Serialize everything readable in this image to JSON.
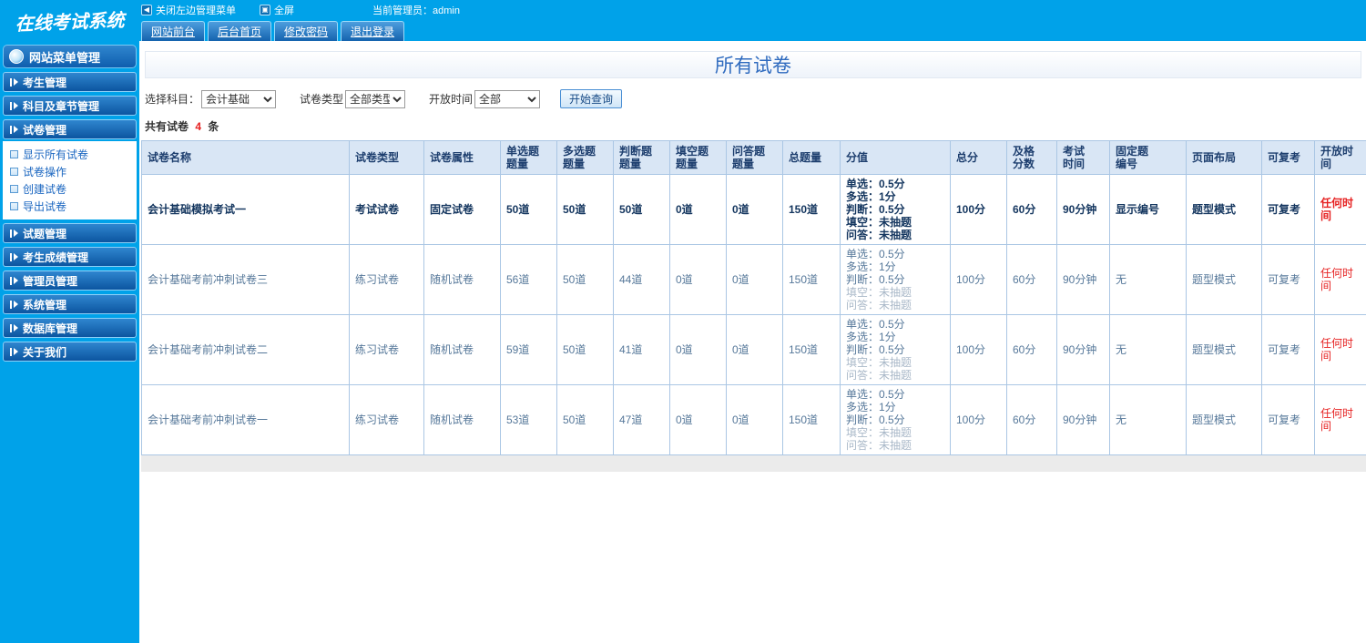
{
  "topbar": {
    "logo": "在线考试系统",
    "close_menu_label": "关闭左边管理菜单",
    "fullscreen_label": "全屏",
    "admin_text": "当前管理员：admin",
    "tabs": [
      "网站前台",
      "后台首页",
      "修改密码",
      "退出登录"
    ]
  },
  "sidebar": {
    "title": "网站菜单管理",
    "items": [
      "考生管理",
      "科目及章节管理",
      "试卷管理",
      "试题管理",
      "考生成绩管理",
      "管理员管理",
      "系统管理",
      "数据库管理",
      "关于我们"
    ],
    "paper_submenu": [
      "显示所有试卷",
      "试卷操作",
      "创建试卷",
      "导出试卷"
    ]
  },
  "main": {
    "title": "所有试卷",
    "filters": {
      "subject_label": "选择科目：",
      "subject_value": "会计基础",
      "type_label": "试卷类型",
      "type_value": "全部类型",
      "time_label": "开放时间",
      "time_value": "全部",
      "search_button": "开始查询"
    },
    "summary": {
      "prefix": "共有试卷",
      "count": "4",
      "suffix": "条"
    },
    "table": {
      "headers": [
        [
          "试卷名称"
        ],
        [
          "试卷类型"
        ],
        [
          "试卷属性"
        ],
        [
          "单选题",
          "题量"
        ],
        [
          "多选题",
          "题量"
        ],
        [
          "判断题",
          "题量"
        ],
        [
          "填空题",
          "题量"
        ],
        [
          "问答题",
          "题量"
        ],
        [
          "总题量"
        ],
        [
          "分值"
        ],
        [
          "总分"
        ],
        [
          "及格",
          "分数"
        ],
        [
          "考试",
          "时间"
        ],
        [
          "固定题",
          "编号"
        ],
        [
          "页面布局"
        ],
        [
          "可复考"
        ],
        [
          "开放时间"
        ]
      ],
      "rows": [
        {
          "name": "会计基础模拟考试一",
          "type": "考试试卷",
          "attr": "固定试卷",
          "single": "50道",
          "multi": "50道",
          "judge": "50道",
          "blank": "0道",
          "qa": "0道",
          "total": "150道",
          "score_lines": [
            "单选：0.5分",
            "多选：1分",
            "判断：0.5分",
            "填空：未抽题",
            "问答：未抽题"
          ],
          "total_score": "100分",
          "pass_score": "60分",
          "duration": "90分钟",
          "fixed_no": "显示编号",
          "layout": "题型模式",
          "retake": "可复考",
          "open_time": "任何时间",
          "emphasis": true
        },
        {
          "name": "会计基础考前冲刺试卷三",
          "type": "练习试卷",
          "attr": "随机试卷",
          "single": "56道",
          "multi": "50道",
          "judge": "44道",
          "blank": "0道",
          "qa": "0道",
          "total": "150道",
          "score_lines": [
            "单选：0.5分",
            "多选：1分",
            "判断：0.5分",
            "填空：未抽题",
            "问答：未抽题"
          ],
          "total_score": "100分",
          "pass_score": "60分",
          "duration": "90分钟",
          "fixed_no": "无",
          "layout": "题型模式",
          "retake": "可复考",
          "open_time": "任何时间",
          "emphasis": false
        },
        {
          "name": "会计基础考前冲刺试卷二",
          "type": "练习试卷",
          "attr": "随机试卷",
          "single": "59道",
          "multi": "50道",
          "judge": "41道",
          "blank": "0道",
          "qa": "0道",
          "total": "150道",
          "score_lines": [
            "单选：0.5分",
            "多选：1分",
            "判断：0.5分",
            "填空：未抽题",
            "问答：未抽题"
          ],
          "total_score": "100分",
          "pass_score": "60分",
          "duration": "90分钟",
          "fixed_no": "无",
          "layout": "题型模式",
          "retake": "可复考",
          "open_time": "任何时间",
          "emphasis": false
        },
        {
          "name": "会计基础考前冲刺试卷一",
          "type": "练习试卷",
          "attr": "随机试卷",
          "single": "53道",
          "multi": "50道",
          "judge": "47道",
          "blank": "0道",
          "qa": "0道",
          "total": "150道",
          "score_lines": [
            "单选：0.5分",
            "多选：1分",
            "判断：0.5分",
            "填空：未抽题",
            "问答：未抽题"
          ],
          "total_score": "100分",
          "pass_score": "60分",
          "duration": "90分钟",
          "fixed_no": "无",
          "layout": "题型模式",
          "retake": "可复考",
          "open_time": "任何时间",
          "emphasis": false
        }
      ]
    }
  },
  "colors": {
    "topbar_blue": "#00a2e9",
    "accent_blue": "#2f6bbf",
    "table_header_bg": "#d9e6f5",
    "table_border": "#aac6e4",
    "alert_red": "#e62020"
  }
}
